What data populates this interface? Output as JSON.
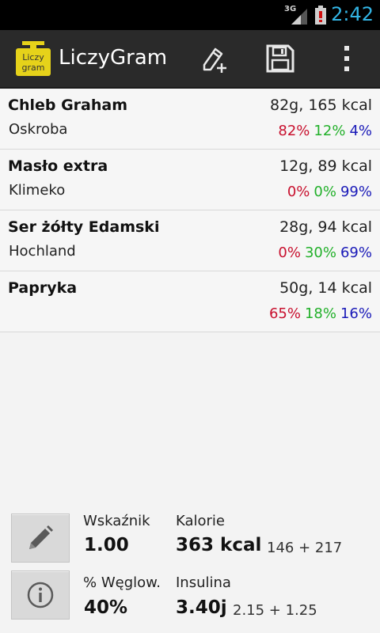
{
  "status_bar": {
    "network": "3G",
    "time": "2:42"
  },
  "app_bar": {
    "logo_text_top": "Liczy",
    "logo_text_bottom": "gram",
    "title": "LiczyGram",
    "actions": [
      {
        "icon": "edit-add-icon"
      },
      {
        "icon": "save-icon"
      },
      {
        "icon": "overflow-menu-icon"
      }
    ]
  },
  "items": [
    {
      "name": "Chleb Graham",
      "brand": "Oskroba",
      "amount": "82g, 165 kcal",
      "carbs": "82%",
      "protein": "12%",
      "fat": "4%"
    },
    {
      "name": "Masło extra",
      "brand": "Klimeko",
      "amount": "12g, 89 kcal",
      "carbs": "0%",
      "protein": "0%",
      "fat": "99%"
    },
    {
      "name": "Ser żółty Edamski",
      "brand": "Hochland",
      "amount": "28g, 94 kcal",
      "carbs": "0%",
      "protein": "30%",
      "fat": "69%"
    },
    {
      "name": "Papryka",
      "brand": "",
      "amount": "50g, 14 kcal",
      "carbs": "65%",
      "protein": "18%",
      "fat": "16%"
    }
  ],
  "colors": {
    "carbs": "#c8102e",
    "protein": "#22b02a",
    "fat": "#1a1ab8",
    "accent": "#33b5e5"
  },
  "summary": {
    "index_label": "Wskaźnik",
    "index_value": "1.00",
    "calories_label": "Kalorie",
    "calories_value": "363 kcal",
    "calories_sub": "146 + 217",
    "carb_label": "% Węglow.",
    "carb_value": "40%",
    "insulin_label": "Insulina",
    "insulin_value": "3.40j",
    "insulin_sub": "2.15 + 1.25",
    "edit_icon": "pencil-icon",
    "info_icon": "info-icon"
  }
}
